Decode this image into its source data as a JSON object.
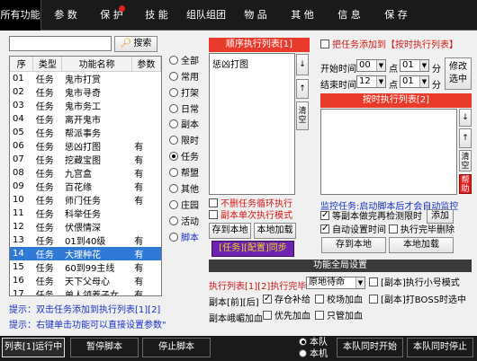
{
  "top_tabs": [
    {
      "label": "所有功能",
      "active": true
    },
    {
      "label": "参  数"
    },
    {
      "label": "保  护"
    },
    {
      "label": "技  能"
    },
    {
      "label": "组队组团"
    },
    {
      "label": "物  品"
    },
    {
      "label": "其  他"
    },
    {
      "label": "信  息"
    },
    {
      "label": "保  存"
    }
  ],
  "search": {
    "value": "",
    "button_label": "搜索",
    "icon": "magnifier-icon"
  },
  "function_table": {
    "columns": [
      "序",
      "类型",
      "功能名称",
      "参数"
    ],
    "rows": [
      [
        "01",
        "任务",
        "鬼市打赏",
        ""
      ],
      [
        "02",
        "任务",
        "鬼市寻奇",
        ""
      ],
      [
        "03",
        "任务",
        "鬼市务工",
        ""
      ],
      [
        "04",
        "任务",
        "离开鬼市",
        ""
      ],
      [
        "05",
        "任务",
        "帮派事务",
        ""
      ],
      [
        "06",
        "任务",
        "惩凶打图",
        "有"
      ],
      [
        "07",
        "任务",
        "挖藏宝图",
        "有"
      ],
      [
        "08",
        "任务",
        "九宫盒",
        "有"
      ],
      [
        "09",
        "任务",
        "百花缘",
        "有"
      ],
      [
        "10",
        "任务",
        "师门任务",
        "有"
      ],
      [
        "11",
        "任务",
        "科举任务",
        ""
      ],
      [
        "12",
        "任务",
        "伏偎情深",
        ""
      ],
      [
        "13",
        "任务",
        "01到40级",
        "有"
      ],
      [
        "14",
        "任务",
        "大理种花",
        "有"
      ],
      [
        "15",
        "任务",
        "60到99主线",
        "有"
      ],
      [
        "16",
        "任务",
        "天下父母心",
        "有"
      ],
      [
        "17",
        "任务",
        "单人领养子女",
        "有"
      ]
    ],
    "selected_row": 13
  },
  "hints": [
    "提示：双击任务添加到执行列表[1][2]",
    "提示：右键单击功能可以直接设置参数\""
  ],
  "categories": [
    {
      "label": "全部",
      "selected": false
    },
    {
      "label": "常用",
      "selected": false
    },
    {
      "label": "打架",
      "selected": false
    },
    {
      "label": "日常",
      "selected": false
    },
    {
      "label": "副本",
      "selected": false
    },
    {
      "label": "限时",
      "selected": false
    },
    {
      "label": "任务",
      "selected": true
    },
    {
      "label": "帮盟",
      "selected": false
    },
    {
      "label": "其他",
      "selected": false
    },
    {
      "label": "庄园",
      "selected": false
    },
    {
      "label": "活动",
      "selected": false
    },
    {
      "label": "脚本",
      "selected": false
    }
  ],
  "seq_list": {
    "title": "顺序执行列表[1]",
    "items": [
      "惩凶打图"
    ],
    "clear_label": "清空",
    "up_icon": "arrow-up-icon",
    "down_icon": "arrow-down-icon",
    "loop_label": "不删任务循环执行",
    "single_label": "副本单次执行模式",
    "save_label": "存到本地",
    "load_label": "本地加载",
    "sync_label": "[任务][配置]同步"
  },
  "sched": {
    "add_label": "把任务添加到【按时执行列表】",
    "start_label": "开始时间",
    "start_hour": "00",
    "start_min": "01",
    "end_label": "结束时间",
    "end_hour": "12",
    "end_min": "01",
    "point_label": "点",
    "minute_label": "分",
    "modify_label": "修改选中",
    "list_title": "按时执行列表[2]",
    "clear_label": "清空",
    "help_label": "帮助",
    "monitor_text": "监控任务:启动脚本后才会自动监控",
    "wait_label": "等副本做完再检测限时",
    "add_btn": "添加",
    "auto_label": "自动设置时间",
    "delete_label": "执行完毕删除",
    "save_label": "存到本地",
    "load_label": "本地加载"
  },
  "global": {
    "title": "功能全局设置",
    "row1_label": "执行列表[1][2]执行完毕",
    "row1_select": "原地待命",
    "row1_check": "[副本]执行小号模式",
    "row2_label": "副本[前][后]",
    "row2_a": "存仓补给",
    "row2_b": "校场加血",
    "row2_c": "[副本]打BOSS时选中",
    "row3_a": "副本峨嵋加血",
    "row3_b": "优先加血",
    "row3_c": "只管加血"
  },
  "bottom": {
    "run_label": "列表[1]运行中",
    "pause_label": "暂停脚本",
    "stop_label": "停止脚本",
    "team_label": "本队",
    "self_label": "本机",
    "start_label": "本队同时开始",
    "stop_all_label": "本队同时停止"
  },
  "colors": {
    "accent_red": "#ea3a2c",
    "hint_blue": "#1a30c8",
    "selection_blue": "#3179d6"
  }
}
